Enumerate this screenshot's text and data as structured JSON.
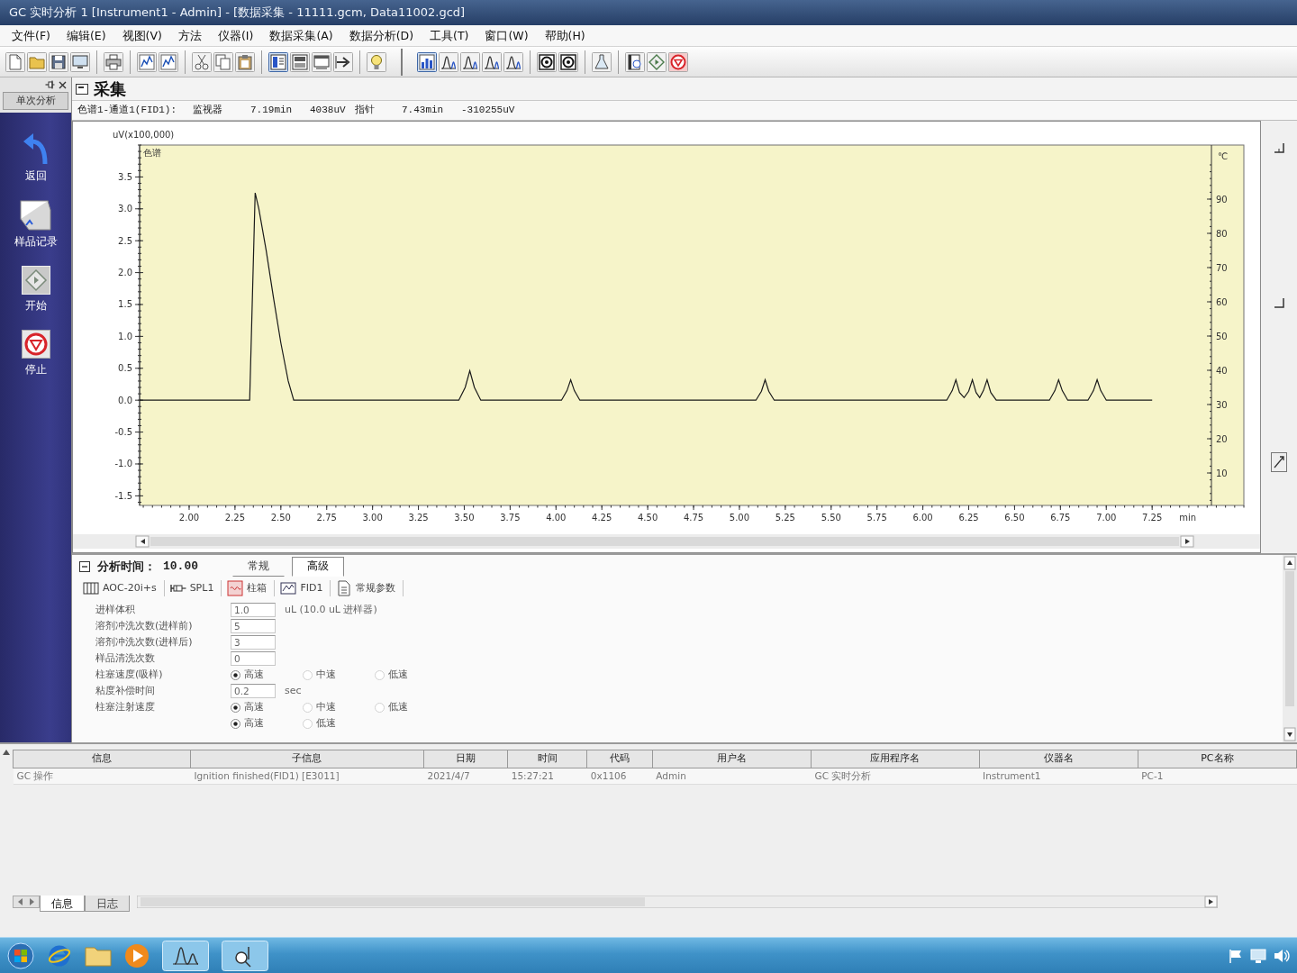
{
  "window": {
    "title": "GC 实时分析 1 [Instrument1 - Admin] - [数据采集 - 11111.gcm, Data11002.gcd]"
  },
  "menu_bar": [
    "文件(F)",
    "编辑(E)",
    "视图(V)",
    "方法",
    "仪器(I)",
    "数据采集(A)",
    "数据分析(D)",
    "工具(T)",
    "窗口(W)",
    "帮助(H)"
  ],
  "side_panel": {
    "title": "单次分析",
    "items": [
      {
        "kind": "back",
        "label": "返回"
      },
      {
        "kind": "record",
        "label": "样品记录"
      },
      {
        "kind": "start",
        "label": "开始"
      },
      {
        "kind": "stop",
        "label": "停止"
      }
    ]
  },
  "acquisition": {
    "title": "采集",
    "status": {
      "channel": "色谱1-通道1(FID1):",
      "monitor_label": "监视器",
      "monitor_time": "7.19min",
      "monitor_signal": "4038uV",
      "cursor_label": "指针",
      "cursor_time": "7.43min",
      "cursor_signal": "-310255uV"
    },
    "chromatogram": {
      "chart_data": {
        "type": "line",
        "ylabel": "uV(x100,000)",
        "xlabel": "min",
        "x": [
          1.73,
          2.33,
          2.345,
          2.36,
          2.38,
          2.42,
          2.46,
          2.5,
          2.54,
          2.57,
          3.47,
          3.505,
          3.53,
          3.555,
          3.59,
          4.03,
          4.06,
          4.08,
          4.1,
          4.13,
          5.09,
          5.12,
          5.14,
          5.16,
          5.19,
          6.13,
          6.16,
          6.18,
          6.2,
          6.225,
          6.25,
          6.27,
          6.29,
          6.31,
          6.33,
          6.35,
          6.37,
          6.4,
          6.69,
          6.72,
          6.74,
          6.76,
          6.79,
          6.9,
          6.93,
          6.95,
          6.97,
          7.0,
          7.25
        ],
        "series": [
          {
            "name": "色谱",
            "color": "#1a1a1a",
            "values": [
              0,
              0,
              1.6,
              3.25,
              3.0,
              2.35,
              1.6,
              0.9,
              0.3,
              0,
              0,
              0.2,
              0.46,
              0.2,
              0,
              0,
              0.15,
              0.32,
              0.15,
              0,
              0,
              0.14,
              0.32,
              0.14,
              0,
              0,
              0.15,
              0.32,
              0.12,
              0.04,
              0.14,
              0.32,
              0.12,
              0.04,
              0.15,
              0.32,
              0.12,
              0,
              0,
              0.15,
              0.32,
              0.15,
              0,
              0,
              0.15,
              0.32,
              0.15,
              0,
              0
            ]
          }
        ],
        "xlim": [
          1.73,
          7.75
        ],
        "ylim": [
          -1.65,
          4.0
        ],
        "xticks": [
          {
            "value": 2.0,
            "label": "2.00"
          },
          {
            "value": 2.25,
            "label": "2.25"
          },
          {
            "value": 2.5,
            "label": "2.50"
          },
          {
            "value": 2.75,
            "label": "2.75"
          },
          {
            "value": 3.0,
            "label": "3.00"
          },
          {
            "value": 3.25,
            "label": "3.25"
          },
          {
            "value": 3.5,
            "label": "3.50"
          },
          {
            "value": 3.75,
            "label": "3.75"
          },
          {
            "value": 4.0,
            "label": "4.00"
          },
          {
            "value": 4.25,
            "label": "4.25"
          },
          {
            "value": 4.5,
            "label": "4.50"
          },
          {
            "value": 4.75,
            "label": "4.75"
          },
          {
            "value": 5.0,
            "label": "5.00"
          },
          {
            "value": 5.25,
            "label": "5.25"
          },
          {
            "value": 5.5,
            "label": "5.50"
          },
          {
            "value": 5.75,
            "label": "5.75"
          },
          {
            "value": 6.0,
            "label": "6.00"
          },
          {
            "value": 6.25,
            "label": "6.25"
          },
          {
            "value": 6.5,
            "label": "6.50"
          },
          {
            "value": 6.75,
            "label": "6.75"
          },
          {
            "value": 7.0,
            "label": "7.00"
          },
          {
            "value": 7.25,
            "label": "7.25"
          }
        ],
        "yticks": [
          {
            "value": 3.5,
            "label": "3.5"
          },
          {
            "value": 3.0,
            "label": "3.0"
          },
          {
            "value": 2.5,
            "label": "2.5"
          },
          {
            "value": 2.0,
            "label": "2.0"
          },
          {
            "value": 1.5,
            "label": "1.5"
          },
          {
            "value": 1.0,
            "label": "1.0"
          },
          {
            "value": 0.5,
            "label": "0.5"
          },
          {
            "value": 0.0,
            "label": "0.0"
          },
          {
            "value": -0.5,
            "label": "-0.5"
          },
          {
            "value": -1.0,
            "label": "-1.0"
          },
          {
            "value": -1.5,
            "label": "-1.5"
          }
        ]
      },
      "temperature_axis": {
        "unit": "℃",
        "ticks": [
          "90",
          "80",
          "70",
          "60",
          "50",
          "40",
          "30",
          "20",
          "10"
        ]
      }
    }
  },
  "method_panel": {
    "analysis_time_label": "分析时间：",
    "analysis_time": "10.00",
    "tabs": [
      {
        "label": "常规",
        "selected": false
      },
      {
        "label": "高级",
        "selected": true
      }
    ],
    "units": [
      {
        "kind": "autosampler",
        "label": "AOC-20i+s"
      },
      {
        "kind": "injector",
        "label": "SPL1"
      },
      {
        "kind": "oven",
        "label": "柱箱"
      },
      {
        "kind": "detector",
        "label": "FID1"
      },
      {
        "kind": "general",
        "label": "常规参数"
      }
    ],
    "fields": [
      {
        "kind": "number",
        "label": "进样体积",
        "value": "1.0",
        "unit": "uL  (10.0 uL 进样器)"
      },
      {
        "kind": "number",
        "label": "溶剂冲洗次数(进样前)",
        "value": "5"
      },
      {
        "kind": "number",
        "label": "溶剂冲洗次数(进样后)",
        "value": "3"
      },
      {
        "kind": "number",
        "label": "样品清洗次数",
        "value": "0"
      },
      {
        "kind": "radio",
        "label": "柱塞速度(吸样)",
        "options": [
          {
            "label": "高速",
            "selected": true
          },
          {
            "label": "中速",
            "selected": false
          },
          {
            "label": "低速",
            "selected": false
          }
        ]
      },
      {
        "kind": "number",
        "label": "粘度补偿时间",
        "value": "0.2",
        "unit": "sec"
      },
      {
        "kind": "radio",
        "label": "柱塞注射速度",
        "options": [
          {
            "label": "高速",
            "selected": true
          },
          {
            "label": "中速",
            "selected": false
          },
          {
            "label": "低速",
            "selected": false
          }
        ]
      },
      {
        "kind": "radio",
        "options": [
          {
            "label": "高速",
            "selected": true
          },
          {
            "label": "低速",
            "selected": false
          }
        ]
      }
    ]
  },
  "output": {
    "columns": [
      "信息",
      "子信息",
      "日期",
      "时间",
      "代码",
      "用户名",
      "应用程序名",
      "仪器名",
      "PC名称"
    ],
    "rows": [
      [
        "GC 操作",
        "Ignition finished(FID1) [E3011]",
        "2021/4/7",
        "15:27:21",
        "0x1106",
        "Admin",
        "GC 实时分析",
        "Instrument1",
        "PC-1"
      ]
    ],
    "tabs": [
      {
        "label": "信息",
        "selected": true
      },
      {
        "label": "日志",
        "selected": false
      }
    ]
  }
}
